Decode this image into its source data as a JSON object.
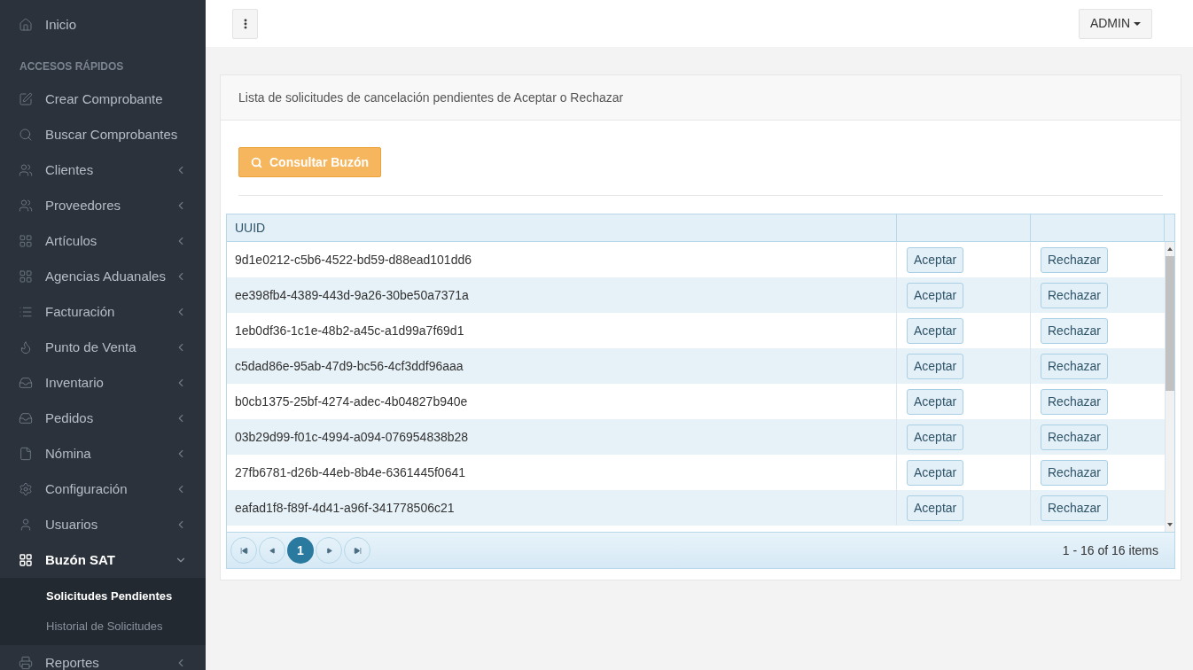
{
  "sidebar": {
    "items": [
      {
        "label": "Inicio",
        "selected": false
      },
      {
        "kind": "heading",
        "label": "ACCESOS RÁPIDOS"
      },
      {
        "label": "Crear Comprobante",
        "selected": false
      },
      {
        "label": "Buscar Comprobantes",
        "selected": false
      },
      {
        "label": "Clientes",
        "expanded": false,
        "selected": false
      },
      {
        "label": "Proveedores",
        "expanded": false,
        "selected": false
      },
      {
        "label": "Artículos",
        "expanded": false,
        "selected": false
      },
      {
        "label": "Agencias Aduanales",
        "expanded": false,
        "selected": false
      },
      {
        "label": "Facturación",
        "expanded": false,
        "selected": false
      },
      {
        "label": "Punto de Venta",
        "expanded": false,
        "selected": false
      },
      {
        "label": "Inventario",
        "expanded": false,
        "selected": false
      },
      {
        "label": "Pedidos",
        "expanded": false,
        "selected": false
      },
      {
        "label": "Nómina",
        "expanded": false,
        "selected": false
      },
      {
        "label": "Configuración",
        "expanded": false,
        "selected": false
      },
      {
        "label": "Usuarios",
        "expanded": false,
        "selected": false
      },
      {
        "label": "Buzón SAT",
        "expanded": true,
        "selected": true,
        "children": [
          {
            "label": "Solicitudes Pendientes",
            "selected": true
          },
          {
            "label": "Historial de Solicitudes",
            "selected": false
          }
        ]
      },
      {
        "label": "Reportes",
        "expanded": false,
        "selected": false
      }
    ]
  },
  "topbar": {
    "user_menu": "ADMIN"
  },
  "panel": {
    "title": "Lista de solicitudes de cancelación pendientes de Aceptar o Rechazar",
    "search_button": "Consultar Buzón",
    "table": {
      "columns": [
        "UUID"
      ],
      "rows": [
        {
          "uuid": "9d1e0212-c5b6-4522-bd59-d88ead101dd6",
          "accept": "Aceptar",
          "reject": "Rechazar"
        },
        {
          "uuid": "ee398fb4-4389-443d-9a26-30be50a7371a",
          "accept": "Aceptar",
          "reject": "Rechazar"
        },
        {
          "uuid": "1eb0df36-1c1e-48b2-a45c-a1d99a7f69d1",
          "accept": "Aceptar",
          "reject": "Rechazar"
        },
        {
          "uuid": "c5dad86e-95ab-47d9-bc56-4cf3ddf96aaa",
          "accept": "Aceptar",
          "reject": "Rechazar"
        },
        {
          "uuid": "b0cb1375-25bf-4274-adec-4b04827b940e",
          "accept": "Aceptar",
          "reject": "Rechazar"
        },
        {
          "uuid": "03b29d99-f01c-4994-a094-076954838b28",
          "accept": "Aceptar",
          "reject": "Rechazar"
        },
        {
          "uuid": "27fb6781-d26b-44eb-8b4e-6361445f0641",
          "accept": "Aceptar",
          "reject": "Rechazar"
        },
        {
          "uuid": "eafad1f8-f89f-4d41-a96f-341778506c21",
          "accept": "Aceptar",
          "reject": "Rechazar"
        }
      ],
      "pager": {
        "pages": [
          {
            "label": "1",
            "selected": true
          }
        ],
        "summary": "1 - 16 of 16 items"
      }
    }
  }
}
